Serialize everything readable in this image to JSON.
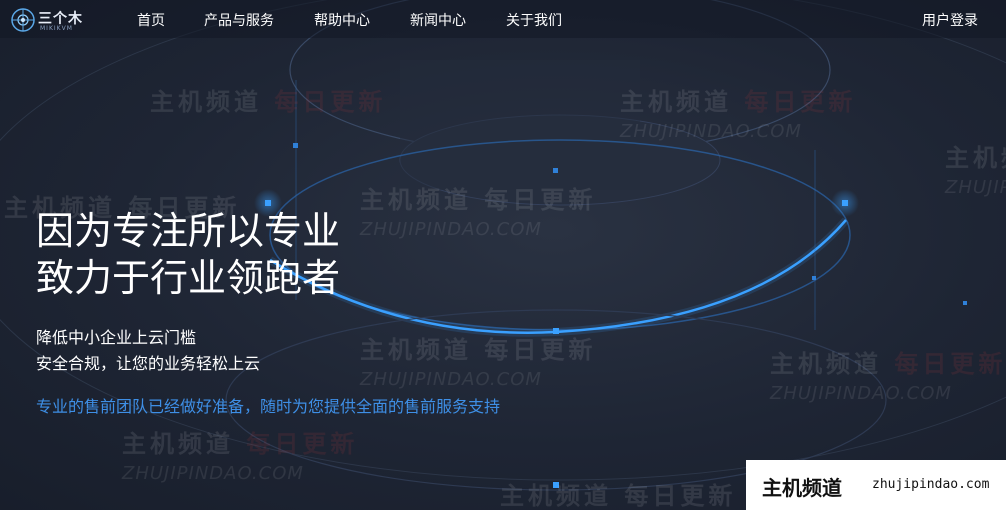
{
  "brand": {
    "name": "三个木",
    "subtitle": "MIKIKVM"
  },
  "nav": {
    "items": [
      "首页",
      "产品与服务",
      "帮助中心",
      "新闻中心",
      "关于我们"
    ],
    "login": "用户登录"
  },
  "hero": {
    "headline_line1": "因为专注所以专业",
    "headline_line2": "致力于行业领跑者",
    "sub_line1": "降低中小企业上云门槛",
    "sub_line2": "安全合规，让您的业务轻松上云",
    "tagline": "专业的售前团队已经做好准备，随时为您提供全面的售前服务支持"
  },
  "watermark": {
    "cn_main": "主机频道",
    "cn_red": "每日更新",
    "en": "ZHUJIPINDAO.COM"
  },
  "badge": {
    "cn": "主机频道",
    "en": "zhujipindao.com"
  },
  "colors": {
    "accent": "#3e8fe6",
    "glow": "#2f9bff",
    "bg": "#1b2231"
  }
}
